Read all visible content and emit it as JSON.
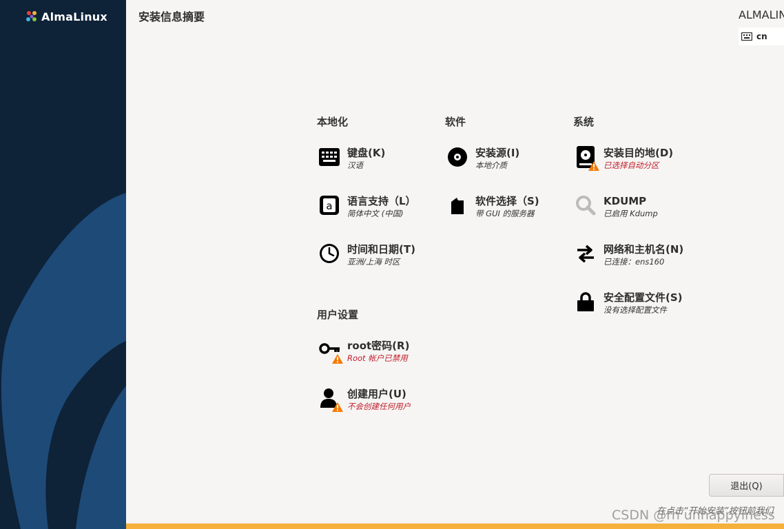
{
  "sidebar": {
    "logo_text": "AlmaLinux"
  },
  "header": {
    "page_title": "安装信息摘要",
    "product": "ALMALINUX",
    "keyboard_layout": "cn"
  },
  "sections": {
    "localization": {
      "title": "本地化",
      "keyboard": {
        "name": "键盘(K)",
        "status": "汉语"
      },
      "language": {
        "name": "语言支持（L）",
        "status": "简体中文 (中国)"
      },
      "time": {
        "name": "时间和日期(T)",
        "status": "亚洲/上海 时区"
      }
    },
    "software": {
      "title": "软件",
      "source": {
        "name": "安装源(I)",
        "status": "本地介质"
      },
      "selection": {
        "name": "软件选择（S)",
        "status": "带 GUI 的服务器"
      }
    },
    "system": {
      "title": "系统",
      "destination": {
        "name": "安装目的地(D)",
        "status": "已选择自动分区"
      },
      "kdump": {
        "name": "KDUMP",
        "status": "已启用 Kdump"
      },
      "network": {
        "name": "网络和主机名(N)",
        "status": "已连接：ens160"
      },
      "security": {
        "name": "安全配置文件(S)",
        "status": "没有选择配置文件"
      }
    },
    "user": {
      "title": "用户设置",
      "root": {
        "name": "root密码(R)",
        "status": "Root 帐户已禁用"
      },
      "create_user": {
        "name": "创建用户(U)",
        "status": "不会创建任何用户"
      }
    }
  },
  "footer": {
    "quit_label": "退出(Q)",
    "hint": "在点击“开始安装”按钮前我们",
    "watermark": "CSDN @rn unhappyiness"
  },
  "colors": {
    "sidebar_bg": "#0e2238",
    "sidebar_shape": "#1e4a78",
    "warning": "#f57900",
    "error_text": "#c01c28",
    "bottom_bar": "#f5b13c"
  }
}
